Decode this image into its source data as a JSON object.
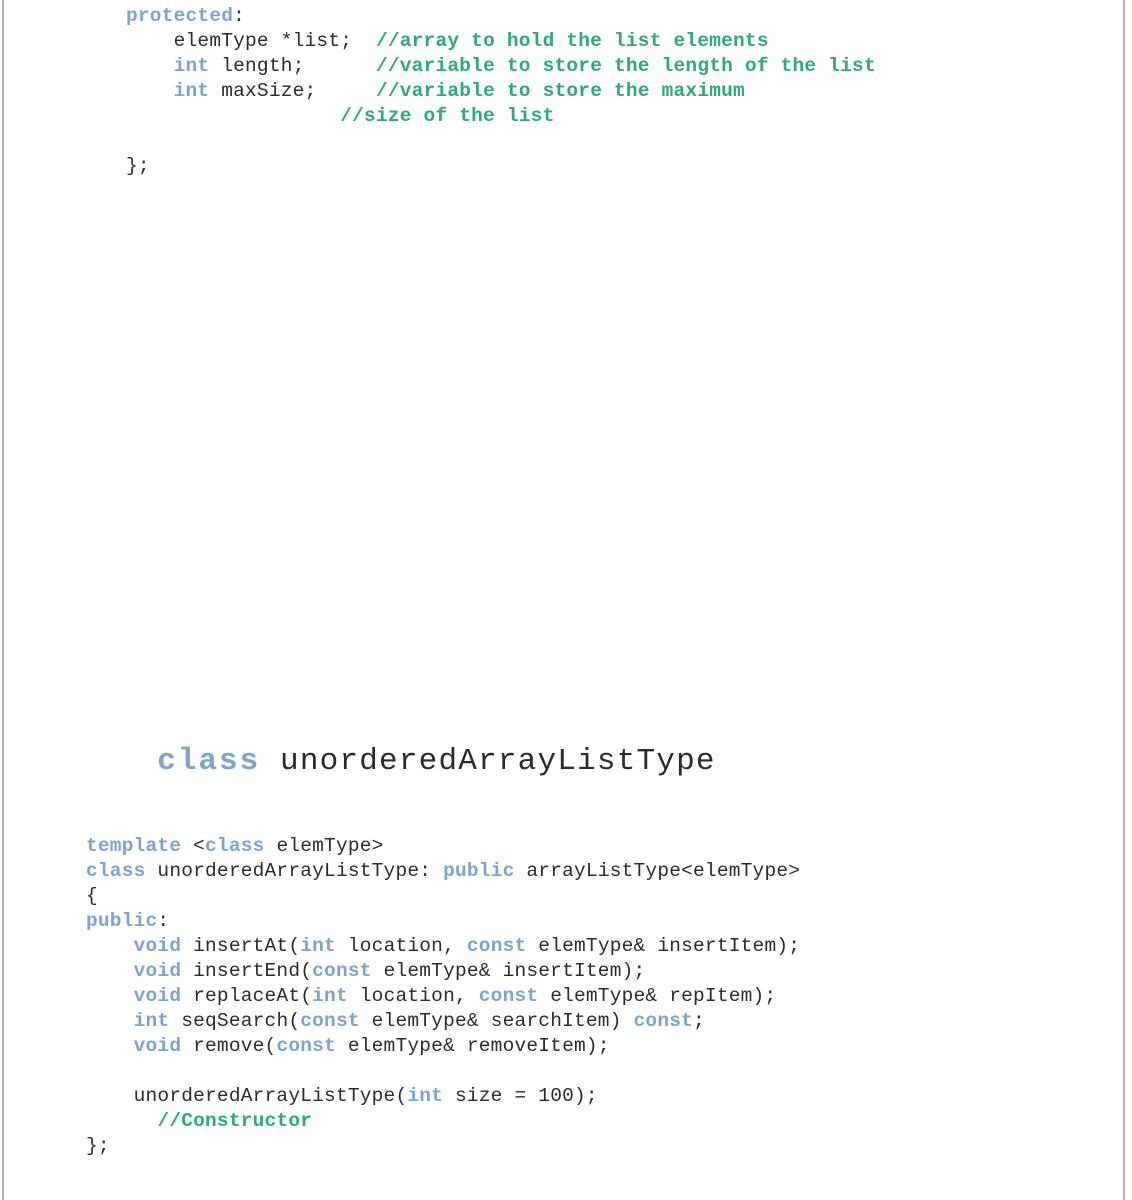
{
  "page": {
    "background_color": "#ffffff",
    "rule_color": "#b3b3b5",
    "keyword_color": "#7ea3cc",
    "comment_color": "#2fa87c",
    "text_color": "#2b2b2b"
  },
  "top_fragment": {
    "lines": [
      {
        "segments": [
          {
            "t": "kw",
            "s": "protected"
          },
          {
            "t": "plain",
            "s": ":"
          }
        ]
      },
      {
        "segments": [
          {
            "t": "plain",
            "s": "    elemType *list;  "
          },
          {
            "t": "cmt",
            "s": "//array to hold the list elements"
          }
        ]
      },
      {
        "segments": [
          {
            "t": "plain",
            "s": "    "
          },
          {
            "t": "kw",
            "s": "int"
          },
          {
            "t": "plain",
            "s": " length;      "
          },
          {
            "t": "cmt",
            "s": "//variable to store the length of the list"
          }
        ]
      },
      {
        "segments": [
          {
            "t": "plain",
            "s": "    "
          },
          {
            "t": "kw",
            "s": "int"
          },
          {
            "t": "plain",
            "s": " maxSize;     "
          },
          {
            "t": "cmt",
            "s": "//variable to store the maximum"
          }
        ]
      },
      {
        "segments": [
          {
            "t": "plain",
            "s": "                  "
          },
          {
            "t": "cmt",
            "s": "//size of the list"
          }
        ]
      },
      {
        "segments": [
          {
            "t": "plain",
            "s": ""
          }
        ]
      },
      {
        "segments": [
          {
            "t": "plain",
            "s": "};"
          }
        ]
      }
    ]
  },
  "heading": {
    "keyword": "class",
    "space": " ",
    "name": "unorderedArrayListType"
  },
  "bottom_fragment": {
    "lines": [
      {
        "segments": [
          {
            "t": "kw",
            "s": "template"
          },
          {
            "t": "plain",
            "s": " <"
          },
          {
            "t": "kw",
            "s": "class"
          },
          {
            "t": "plain",
            "s": " elemType>"
          }
        ]
      },
      {
        "segments": [
          {
            "t": "kw",
            "s": "class"
          },
          {
            "t": "plain",
            "s": " unorderedArrayListType: "
          },
          {
            "t": "kw",
            "s": "public"
          },
          {
            "t": "plain",
            "s": " arrayListType<elemType>"
          }
        ]
      },
      {
        "segments": [
          {
            "t": "plain",
            "s": "{"
          }
        ]
      },
      {
        "segments": [
          {
            "t": "kw",
            "s": "public"
          },
          {
            "t": "plain",
            "s": ":"
          }
        ]
      },
      {
        "segments": [
          {
            "t": "plain",
            "s": "    "
          },
          {
            "t": "kw",
            "s": "void"
          },
          {
            "t": "plain",
            "s": " insertAt("
          },
          {
            "t": "kw",
            "s": "int"
          },
          {
            "t": "plain",
            "s": " location, "
          },
          {
            "t": "kw",
            "s": "const"
          },
          {
            "t": "plain",
            "s": " elemType& insertItem);"
          }
        ]
      },
      {
        "segments": [
          {
            "t": "plain",
            "s": "    "
          },
          {
            "t": "kw",
            "s": "void"
          },
          {
            "t": "plain",
            "s": " insertEnd("
          },
          {
            "t": "kw",
            "s": "const"
          },
          {
            "t": "plain",
            "s": " elemType& insertItem);"
          }
        ]
      },
      {
        "segments": [
          {
            "t": "plain",
            "s": "    "
          },
          {
            "t": "kw",
            "s": "void"
          },
          {
            "t": "plain",
            "s": " replaceAt("
          },
          {
            "t": "kw",
            "s": "int"
          },
          {
            "t": "plain",
            "s": " location, "
          },
          {
            "t": "kw",
            "s": "const"
          },
          {
            "t": "plain",
            "s": " elemType& repItem);"
          }
        ]
      },
      {
        "segments": [
          {
            "t": "plain",
            "s": "    "
          },
          {
            "t": "kw",
            "s": "int"
          },
          {
            "t": "plain",
            "s": " seqSearch("
          },
          {
            "t": "kw",
            "s": "const"
          },
          {
            "t": "plain",
            "s": " elemType& searchItem) "
          },
          {
            "t": "kw",
            "s": "const"
          },
          {
            "t": "plain",
            "s": ";"
          }
        ]
      },
      {
        "segments": [
          {
            "t": "plain",
            "s": "    "
          },
          {
            "t": "kw",
            "s": "void"
          },
          {
            "t": "plain",
            "s": " remove("
          },
          {
            "t": "kw",
            "s": "const"
          },
          {
            "t": "plain",
            "s": " elemType& removeItem);"
          }
        ]
      },
      {
        "segments": [
          {
            "t": "plain",
            "s": ""
          }
        ]
      },
      {
        "segments": [
          {
            "t": "plain",
            "s": "    unorderedArrayListType("
          },
          {
            "t": "kw",
            "s": "int"
          },
          {
            "t": "plain",
            "s": " size = 100);"
          }
        ]
      },
      {
        "segments": [
          {
            "t": "plain",
            "s": "      "
          },
          {
            "t": "cmt",
            "s": "//Constructor"
          }
        ]
      },
      {
        "segments": [
          {
            "t": "plain",
            "s": "};"
          }
        ]
      }
    ]
  }
}
